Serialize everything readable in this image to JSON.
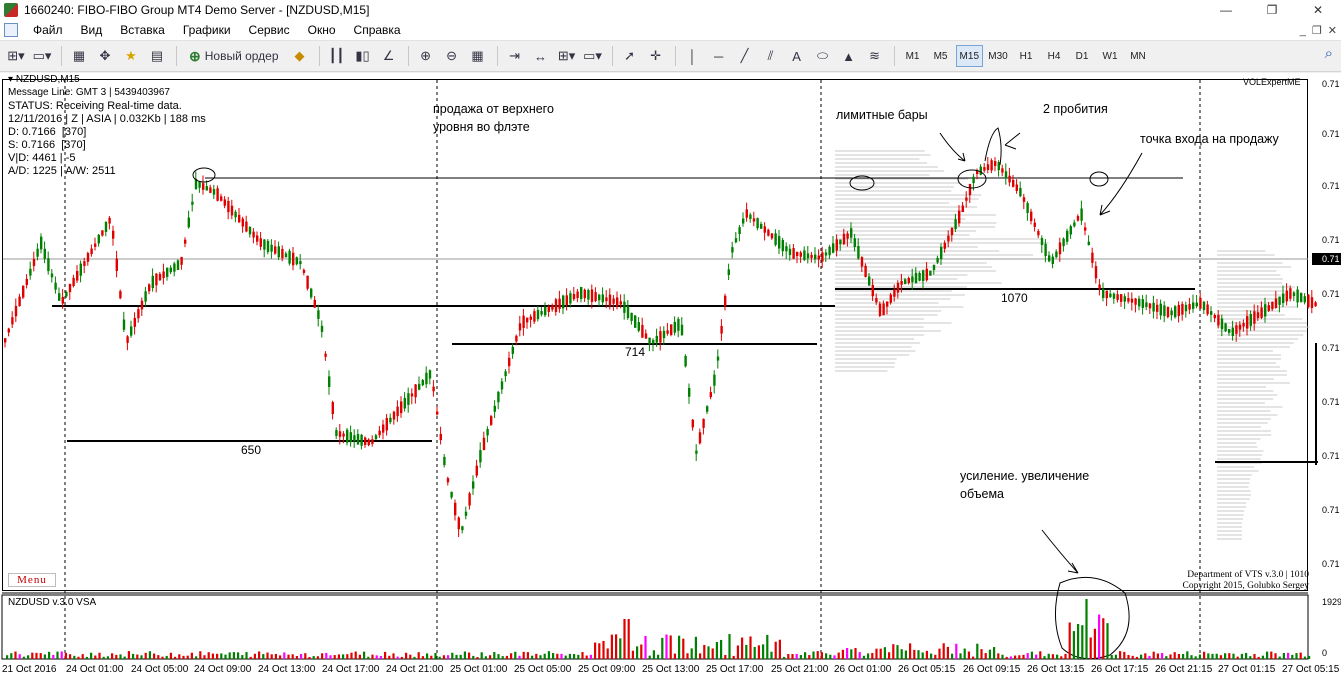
{
  "window": {
    "title": "1660240: FIBO-FIBO Group MT4 Demo Server - [NZDUSD,M15]",
    "minimize": "—",
    "restore": "❐",
    "close": "✕"
  },
  "menu": {
    "items": [
      "Файл",
      "Вид",
      "Вставка",
      "Графики",
      "Сервис",
      "Окно",
      "Справка"
    ],
    "mdi_min": "_",
    "mdi_restore": "❐",
    "mdi_close": "✕"
  },
  "toolbar": {
    "new_order_label": "Новый ордер",
    "timeframes": [
      "M1",
      "M5",
      "M15",
      "M30",
      "H1",
      "H4",
      "D1",
      "W1",
      "MN"
    ],
    "active_timeframe": "M15",
    "text_tool": "A"
  },
  "chart": {
    "symbol_header": "NZDUSD,M15",
    "info_lines": [
      "Message Line: GMT 3 | 5439403967",
      "STATUS: Receiving Real-time data.",
      "12/11/2016 | Z | ASIA | 0.032Kb | 188 ms",
      "D: 0.7166  [370]",
      "S: 0.7166  [370]",
      "V|D: 4461 | -5",
      "A/D: 1225 | A/W: 2511"
    ],
    "menu_button": "Menu",
    "indicator_name": "VOLExpertME",
    "copyright_line1": "Department of VTS  v.3.0 | 1010",
    "copyright_line2": "Copyright 2015, Golubko Sergey",
    "annotations": {
      "sell_from_top": "продажа от верхнего\nуровня во флэте",
      "limit_bars": "лимитные бары",
      "two_breaks": "2 пробития",
      "entry_point": "точка входа на продажу",
      "strengthening": "усиление. увеличение\nобъема"
    },
    "levels": {
      "l650": "650",
      "l714": "714",
      "l1070": "1070"
    },
    "price_labels": [
      "0.71",
      "0.71",
      "0.71",
      "0.71",
      "0.71",
      "0.71",
      "0.71",
      "0.71",
      "0.71",
      "0.71",
      "0.71"
    ],
    "current_price": "0.71",
    "colors": {
      "bull": "#008000",
      "bear": "#e00000",
      "volume_climax": "#ff00ff",
      "level_line": "#000000",
      "profile": "#c8c8c8"
    }
  },
  "subwindow": {
    "title": "NZDUSD v.3.0 VSA",
    "max_label": "1929",
    "zero_label": "0"
  },
  "time_axis": {
    "labels": [
      "21 Oct 2016",
      "24 Oct 01:00",
      "24 Oct 05:00",
      "24 Oct 09:00",
      "24 Oct 13:00",
      "24 Oct 17:00",
      "24 Oct 21:00",
      "25 Oct 01:00",
      "25 Oct 05:00",
      "25 Oct 09:00",
      "25 Oct 13:00",
      "25 Oct 17:00",
      "25 Oct 21:00",
      "26 Oct 01:00",
      "26 Oct 05:15",
      "26 Oct 09:15",
      "26 Oct 13:15",
      "26 Oct 17:15",
      "26 Oct 21:15",
      "27 Oct 01:15",
      "27 Oct 05:15"
    ]
  },
  "chart_data": {
    "type": "candlestick",
    "symbol": "NZDUSD",
    "timeframe": "M15",
    "levels": [
      650,
      714,
      1070
    ],
    "x": [
      "21 Oct 2016",
      "24 Oct 01:00",
      "24 Oct 05:00",
      "24 Oct 09:00",
      "24 Oct 13:00",
      "24 Oct 17:00",
      "24 Oct 21:00",
      "25 Oct 01:00",
      "25 Oct 05:00",
      "25 Oct 09:00",
      "25 Oct 13:00",
      "25 Oct 17:00",
      "25 Oct 21:00",
      "26 Oct 01:00",
      "26 Oct 05:15",
      "26 Oct 09:15",
      "26 Oct 13:15",
      "26 Oct 17:15",
      "26 Oct 21:15",
      "27 Oct 01:15",
      "27 Oct 05:15"
    ],
    "grid": false
  }
}
